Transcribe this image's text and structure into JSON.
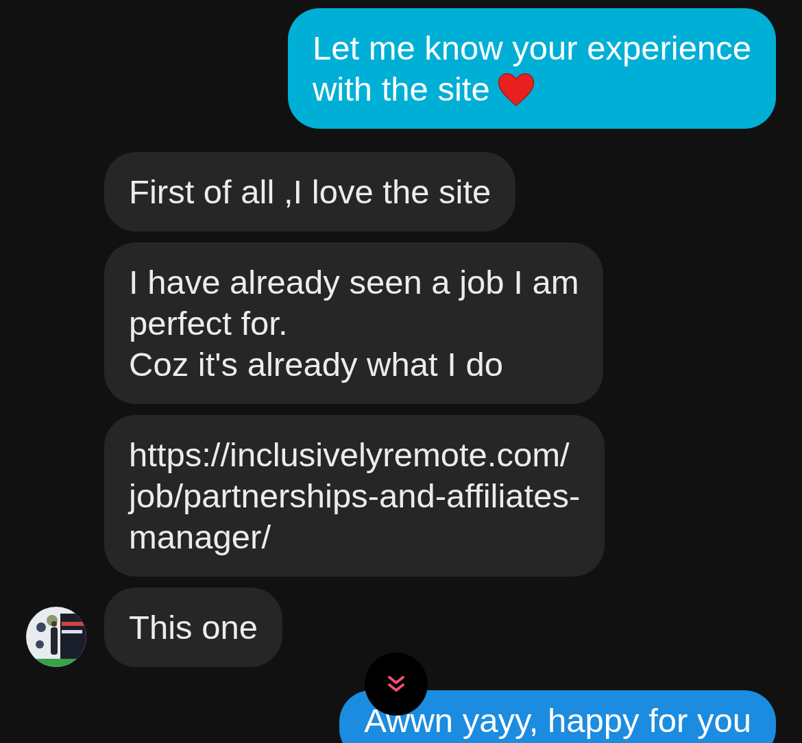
{
  "messages": [
    {
      "kind": "sent",
      "text": "Let me know your experience\nwith the site",
      "heart": true
    },
    {
      "kind": "received",
      "text": "First of all ,I love the site"
    },
    {
      "kind": "received",
      "text": "I have already seen a job I am\nperfect for.\nCoz it's already what I do"
    },
    {
      "kind": "received",
      "text": "https://inclusivelyremote.com/\njob/partnerships-and-affiliates-\nmanager/"
    },
    {
      "kind": "received",
      "text": "This one",
      "avatar": true
    },
    {
      "kind": "sent",
      "text": "Awwn yayy, happy for you"
    }
  ]
}
